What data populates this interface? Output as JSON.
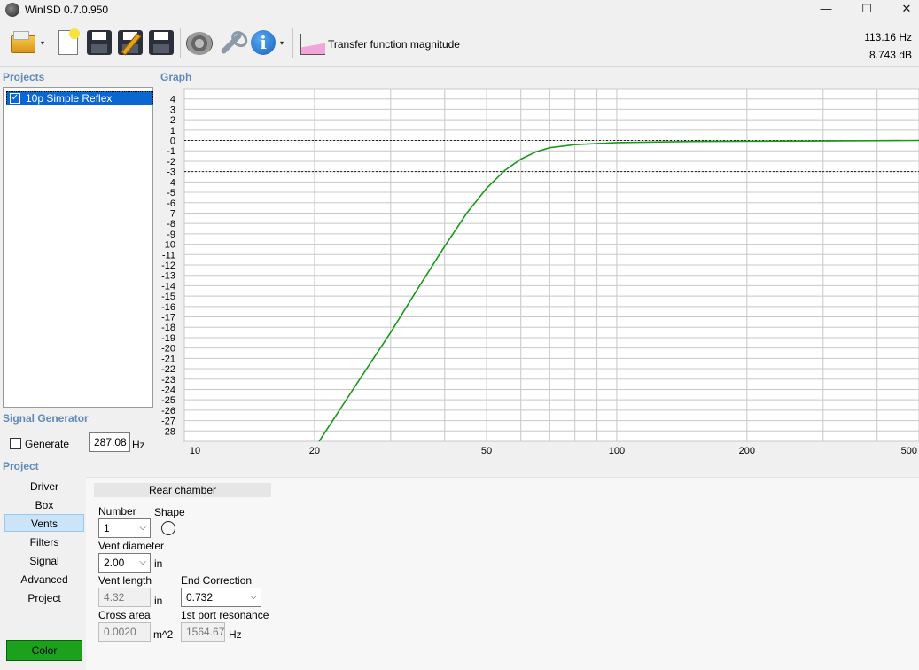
{
  "window": {
    "title": "WinISD 0.7.0.950",
    "minimize_glyph": "—",
    "maximize_glyph": "☐",
    "close_glyph": "✕"
  },
  "toolbar": {
    "icons": [
      "open-project-icon",
      "new-project-icon",
      "save-icon",
      "save-as-icon",
      "save-all-icon",
      "driver-editor-icon",
      "tools-icon",
      "info-icon",
      "transfer-function-icon"
    ],
    "dropdown_glyph": "▾",
    "graph_type_label": "Transfer function magnitude",
    "readout_freq": "113.16 Hz",
    "readout_level": "8.743 dB"
  },
  "projects": {
    "label": "Projects",
    "items": [
      {
        "name": "10p Simple Reflex",
        "checked": true
      }
    ]
  },
  "graph": {
    "label": "Graph"
  },
  "chart_data": {
    "type": "line",
    "title": "",
    "xlabel": "",
    "ylabel": "",
    "x_scale": "log",
    "xlim": [
      10,
      500
    ],
    "ylim": [
      -29,
      5
    ],
    "x_tick_labels": [
      "10",
      "20",
      "50",
      "100",
      "200",
      "500"
    ],
    "y_tick_labels": [
      "4",
      "3",
      "2",
      "1",
      "0",
      "-1",
      "-2",
      "-3",
      "-4",
      "-5",
      "-6",
      "-7",
      "-8",
      "-9",
      "-10",
      "-11",
      "-12",
      "-13",
      "-14",
      "-15",
      "-16",
      "-17",
      "-18",
      "-19",
      "-20",
      "-21",
      "-22",
      "-23",
      "-24",
      "-25",
      "-26",
      "-27",
      "-28"
    ],
    "reference_lines_db": [
      0,
      -3
    ],
    "series": [
      {
        "color": "#1a9a1a",
        "x": [
          20.5,
          25,
          30,
          35,
          40,
          45,
          50,
          55,
          60,
          65,
          70,
          80,
          100,
          150,
          300,
          500
        ],
        "y": [
          -29.5,
          -23.5,
          -18.5,
          -14,
          -10.2,
          -7,
          -4.6,
          -2.9,
          -1.8,
          -1.1,
          -0.7,
          -0.4,
          -0.2,
          -0.1,
          -0.05,
          0
        ]
      }
    ],
    "grid": true
  },
  "signal_generator": {
    "label": "Signal Generator",
    "generate_label": "Generate",
    "generate_checked": false,
    "frequency": "287.08",
    "unit": "Hz"
  },
  "project_nav": {
    "label": "Project",
    "items": [
      "Driver",
      "Box",
      "Vents",
      "Filters",
      "Signal",
      "Advanced",
      "Project"
    ],
    "active": "Vents",
    "color_button": "Color",
    "color_value": "#1ba11b"
  },
  "vents": {
    "tab": "Rear chamber",
    "number_label": "Number",
    "number_value": "1",
    "shape_label": "Shape",
    "diameter_label": "Vent diameter",
    "diameter_value": "2.00",
    "diameter_unit": "in",
    "length_label": "Vent length",
    "length_value": "4.32",
    "length_unit": "in",
    "end_correction_label": "End Correction",
    "end_correction_value": "0.732",
    "cross_area_label": "Cross area",
    "cross_area_value": "0.0020",
    "cross_area_unit": "m^2",
    "resonance_label": "1st port resonance",
    "resonance_value": "1564.67",
    "resonance_unit": "Hz"
  }
}
